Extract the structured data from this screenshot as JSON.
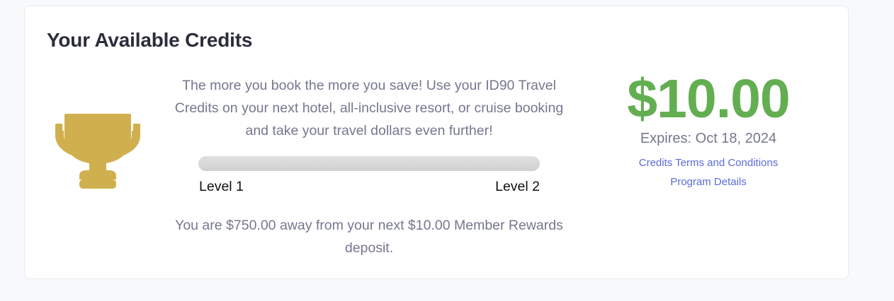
{
  "card": {
    "title": "Your Available Credits"
  },
  "trophy": {
    "icon": "trophy-icon",
    "color": "#d0b04e"
  },
  "info": {
    "description": "The more you book the more you save! Use your ID90 Travel Credits on your next hotel, all-inclusive resort, or cruise booking and take your travel dollars even further!",
    "progress": {
      "fraction": 0,
      "level_start_label": "Level 1",
      "level_end_label": "Level 2"
    },
    "away_message": "You are $750.00 away from your next $10.00 Member Rewards deposit."
  },
  "credits": {
    "amount": "$10.00",
    "expires": "Expires: Oct 18, 2024",
    "terms_link": "Credits Terms and Conditions",
    "program_link": "Program Details",
    "amount_color": "#62ae51",
    "link_color": "#5b6bd5"
  }
}
